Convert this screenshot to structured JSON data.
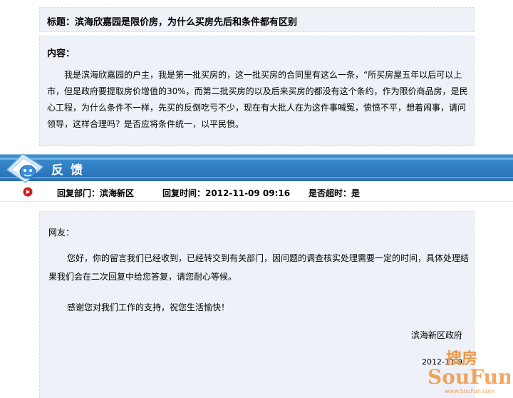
{
  "post": {
    "title": "标题：滨海欣嘉园是限价房，为什么买房先后和条件都有区别",
    "content_label": "内容：",
    "content_body": "我是滨海欣嘉园的户主，我是第一批买房的，这一批买房的合同里有这么一条，“所买房屋五年以后可以上市，但是政府要提取房价增值的30%，而第二批买房的以及后来买房的都没有这个条约，作为限价商品房，是民心工程，为什么条件不一样，先买的反倒吃亏不少，现在有大批人在为这件事喊冤，愤愤不平，想着闹事，请问领导，这样合理吗？是否应将条件统一，以平民愤。"
  },
  "feedback": {
    "section_title": "反馈",
    "icon": "chat-bubble-icon",
    "meta": {
      "dept": "回复部门：滨海新区",
      "time": "回复时间：2012-11-09 09:16",
      "overdue": "是否超时：是"
    },
    "reply": {
      "salutation": "网友：",
      "body": "您好，你的留言我们已经收到，已经转交到有关部门，因问题的调查核实处理需要一定的时间，具体处理结果我们会在二次回复中给您答复，请您耐心等候。",
      "thanks": "感谢您对我们工作的支持，祝您生活愉快！",
      "signature": "滨海新区政府",
      "date": "2012-11-9"
    }
  },
  "watermark": {
    "cn": "搜房",
    "en": "SouFun",
    "url": "www.SouFun.com"
  },
  "colors": {
    "panel_bg": "#eef2f8",
    "bar_blue": "#2f7bc2",
    "arrow_red": "#cc2222",
    "watermark_orange": "#f08a2a"
  }
}
